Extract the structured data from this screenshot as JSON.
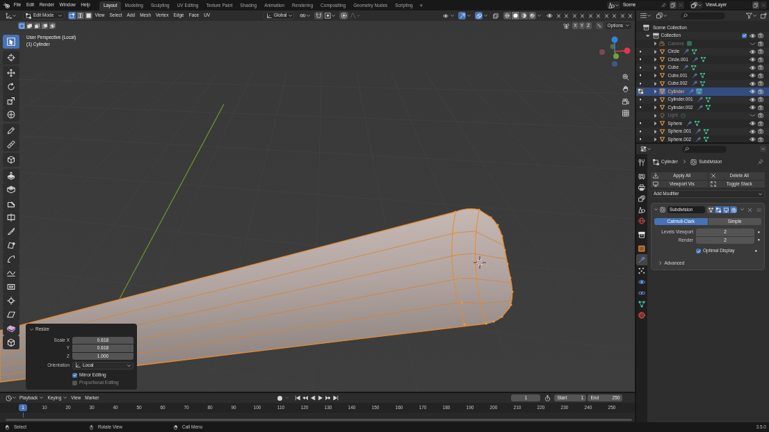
{
  "top_bar": {
    "menus": [
      "File",
      "Edit",
      "Render",
      "Window",
      "Help"
    ],
    "workspaces": [
      {
        "label": "Layout",
        "selected": true
      },
      {
        "label": "Modeling",
        "selected": false
      },
      {
        "label": "Sculpting",
        "selected": false
      },
      {
        "label": "UV Editing",
        "selected": false
      },
      {
        "label": "Texture Paint",
        "selected": false
      },
      {
        "label": "Shading",
        "selected": false
      },
      {
        "label": "Animation",
        "selected": false
      },
      {
        "label": "Rendering",
        "selected": false
      },
      {
        "label": "Compositing",
        "selected": false
      },
      {
        "label": "Geometry Nodes",
        "selected": false
      },
      {
        "label": "Scripting",
        "selected": false
      }
    ],
    "add_workspace": "+",
    "scene": "Scene",
    "view_layer": "ViewLayer"
  },
  "viewport": {
    "header": {
      "mode": "Edit Mode",
      "select_modes": [
        {
          "kind": "vertex",
          "selected": true
        },
        {
          "kind": "edge",
          "selected": false
        },
        {
          "kind": "face",
          "selected": false
        }
      ],
      "menus": [
        "View",
        "Select",
        "Add",
        "Mesh",
        "Vertex",
        "Edge",
        "Face",
        "UV"
      ],
      "orientation": "Global",
      "toggles": [
        {
          "kind": "visibility",
          "on": false
        },
        {
          "kind": "gizmos",
          "on": true
        },
        {
          "kind": "overlays",
          "on": true
        },
        {
          "kind": "xray",
          "on": false
        }
      ],
      "shading": [
        {
          "kind": "wireframe",
          "selected": false
        },
        {
          "kind": "solid",
          "selected": true
        },
        {
          "kind": "material",
          "selected": false
        },
        {
          "kind": "rendered",
          "selected": false
        }
      ]
    },
    "tool_header": {
      "select_modes": [
        {
          "kind": "set",
          "selected": true
        },
        {
          "kind": "extend",
          "selected": false
        },
        {
          "kind": "subtract",
          "selected": false
        },
        {
          "kind": "difference",
          "selected": false
        },
        {
          "kind": "intersect",
          "selected": false
        }
      ],
      "mirror_axes": [
        {
          "label": "X",
          "on": false
        },
        {
          "label": "Y",
          "on": false
        },
        {
          "label": "Z",
          "on": false
        }
      ],
      "options": "Options"
    },
    "info": [
      "User Perspective (Local)",
      "(1) Cylinder"
    ],
    "tools": [
      {
        "kind": "select_box",
        "selected": true
      },
      {
        "kind": "cursor",
        "selected": false
      },
      {
        "kind": "move",
        "selected": false
      },
      {
        "kind": "rotate",
        "selected": false
      },
      {
        "kind": "scale",
        "selected": false
      },
      {
        "kind": "transform",
        "selected": false
      },
      {
        "kind": "annotate",
        "selected": false
      },
      {
        "kind": "measure",
        "selected": false
      },
      {
        "kind": "add_cube",
        "selected": false
      },
      {
        "kind": "extrude",
        "selected": false
      },
      {
        "kind": "inset",
        "selected": false
      },
      {
        "kind": "bevel",
        "selected": false
      },
      {
        "kind": "loop_cut",
        "selected": false
      },
      {
        "kind": "knife",
        "selected": false
      },
      {
        "kind": "poly_build",
        "selected": false
      },
      {
        "kind": "spin",
        "selected": false
      },
      {
        "kind": "smooth",
        "selected": false
      },
      {
        "kind": "edge_slide",
        "selected": false
      },
      {
        "kind": "shrink",
        "selected": false
      },
      {
        "kind": "shear",
        "selected": false
      },
      {
        "kind": "to_sphere",
        "selected": false
      },
      {
        "kind": "rip",
        "selected": false
      }
    ],
    "redo_panel": {
      "title": "Resize",
      "expanded": true,
      "scale": [
        {
          "label": "Scale X",
          "value": "0.618"
        },
        {
          "label": "Y",
          "value": "0.618"
        },
        {
          "label": "Z",
          "value": "1.000"
        }
      ],
      "orientation": {
        "label": "Orientation",
        "value": "Local"
      },
      "options": [
        {
          "label": "Mirror Editing",
          "checked": true
        },
        {
          "label": "Proportional Editing",
          "checked": false
        }
      ]
    }
  },
  "outliner": {
    "tree": {
      "name": "Scene Collection",
      "children": [
        {
          "name": "Collection",
          "expanded": true,
          "checked": true,
          "children": [
            {
              "name": "Camera",
              "kind": "camera",
              "expanded": false,
              "hidden": true,
              "selected": false,
              "edit_mode": false
            },
            {
              "name": "Circle",
              "kind": "mesh",
              "expanded": false,
              "hidden": false,
              "selected": false,
              "edit_mode": false
            },
            {
              "name": "Circle.001",
              "kind": "mesh",
              "expanded": false,
              "hidden": false,
              "selected": false,
              "edit_mode": false
            },
            {
              "name": "Cube",
              "kind": "mesh",
              "expanded": false,
              "hidden": false,
              "selected": false,
              "edit_mode": false
            },
            {
              "name": "Cube.001",
              "kind": "mesh",
              "expanded": false,
              "hidden": false,
              "selected": false,
              "edit_mode": false
            },
            {
              "name": "Cube.002",
              "kind": "mesh",
              "expanded": false,
              "hidden": false,
              "selected": false,
              "edit_mode": false
            },
            {
              "name": "Cylinder",
              "kind": "mesh",
              "expanded": false,
              "hidden": false,
              "selected": true,
              "edit_mode": true
            },
            {
              "name": "Cylinder.001",
              "kind": "mesh",
              "expanded": false,
              "hidden": false,
              "selected": false,
              "edit_mode": false
            },
            {
              "name": "Cylinder.002",
              "kind": "mesh",
              "expanded": false,
              "hidden": false,
              "selected": false,
              "edit_mode": false
            },
            {
              "name": "Light",
              "kind": "light",
              "expanded": false,
              "hidden": true,
              "selected": false,
              "edit_mode": false
            },
            {
              "name": "Sphere",
              "kind": "mesh",
              "expanded": false,
              "hidden": false,
              "selected": false,
              "edit_mode": false
            },
            {
              "name": "Sphere.001",
              "kind": "mesh",
              "expanded": false,
              "hidden": false,
              "selected": false,
              "edit_mode": false
            },
            {
              "name": "Sphere.002",
              "kind": "mesh",
              "expanded": false,
              "hidden": false,
              "selected": false,
              "edit_mode": false
            }
          ]
        }
      ]
    }
  },
  "properties": {
    "tabs": [
      {
        "kind": "tool",
        "selected": false
      },
      {
        "kind": "render",
        "selected": false
      },
      {
        "kind": "output",
        "selected": false
      },
      {
        "kind": "view_layer",
        "selected": false
      },
      {
        "kind": "scene",
        "selected": false
      },
      {
        "kind": "world",
        "selected": false
      },
      {
        "kind": "collection",
        "selected": false
      },
      {
        "kind": "object",
        "selected": false
      },
      {
        "kind": "modifiers",
        "selected": true
      },
      {
        "kind": "particles",
        "selected": false
      },
      {
        "kind": "physics",
        "selected": false
      },
      {
        "kind": "constraints",
        "selected": false
      },
      {
        "kind": "data",
        "selected": false
      },
      {
        "kind": "material",
        "selected": false
      }
    ],
    "breadcrumb": [
      "Cylinder",
      "Subdivision"
    ],
    "actions": [
      {
        "kind": "apply",
        "label": "Apply All"
      },
      {
        "kind": "delete",
        "label": "Delete All"
      },
      {
        "kind": "viewport",
        "label": "Viewport Vis"
      },
      {
        "kind": "toggle",
        "label": "Toggle Stack"
      }
    ],
    "add_modifier": "Add Modifier",
    "modifier": {
      "name": "Subdivision",
      "expanded": true,
      "toggles": [
        {
          "kind": "on_cage",
          "on": false
        },
        {
          "kind": "edit_mode",
          "on": true
        },
        {
          "kind": "viewport",
          "on": true
        },
        {
          "kind": "render",
          "on": true
        }
      ],
      "types": [
        {
          "label": "Catmull-Clark",
          "selected": true
        },
        {
          "label": "Simple",
          "selected": false
        }
      ],
      "fields": [
        {
          "label": "Levels Viewport",
          "value": "2"
        },
        {
          "label": "Render",
          "value": "2"
        }
      ],
      "optimal_display": {
        "label": "Optimal Display",
        "checked": true
      },
      "advanced": {
        "label": "Advanced",
        "expanded": false
      }
    }
  },
  "timeline": {
    "menus": [
      {
        "kind": "dropdown",
        "label": "Playback"
      },
      {
        "kind": "dropdown",
        "label": "Keying"
      },
      {
        "kind": "menu",
        "label": "View"
      },
      {
        "kind": "menu",
        "label": "Marker"
      }
    ],
    "current_frame": "1",
    "start": {
      "label": "Start",
      "value": "1"
    },
    "end": {
      "label": "End",
      "value": "250"
    },
    "playhead": "1",
    "ticks": [
      "10",
      "20",
      "30",
      "40",
      "50",
      "60",
      "70",
      "80",
      "90",
      "100",
      "110",
      "120",
      "130",
      "140",
      "150",
      "160",
      "170",
      "180",
      "190",
      "200",
      "210",
      "220",
      "230",
      "240",
      "250"
    ]
  },
  "status_bar": {
    "hints": [
      {
        "kind": "left_click",
        "label": "Select"
      },
      {
        "kind": "middle_click",
        "label": "Rotate View"
      },
      {
        "kind": "right_click",
        "label": "Call Menu"
      }
    ],
    "version": "3.5.0"
  }
}
